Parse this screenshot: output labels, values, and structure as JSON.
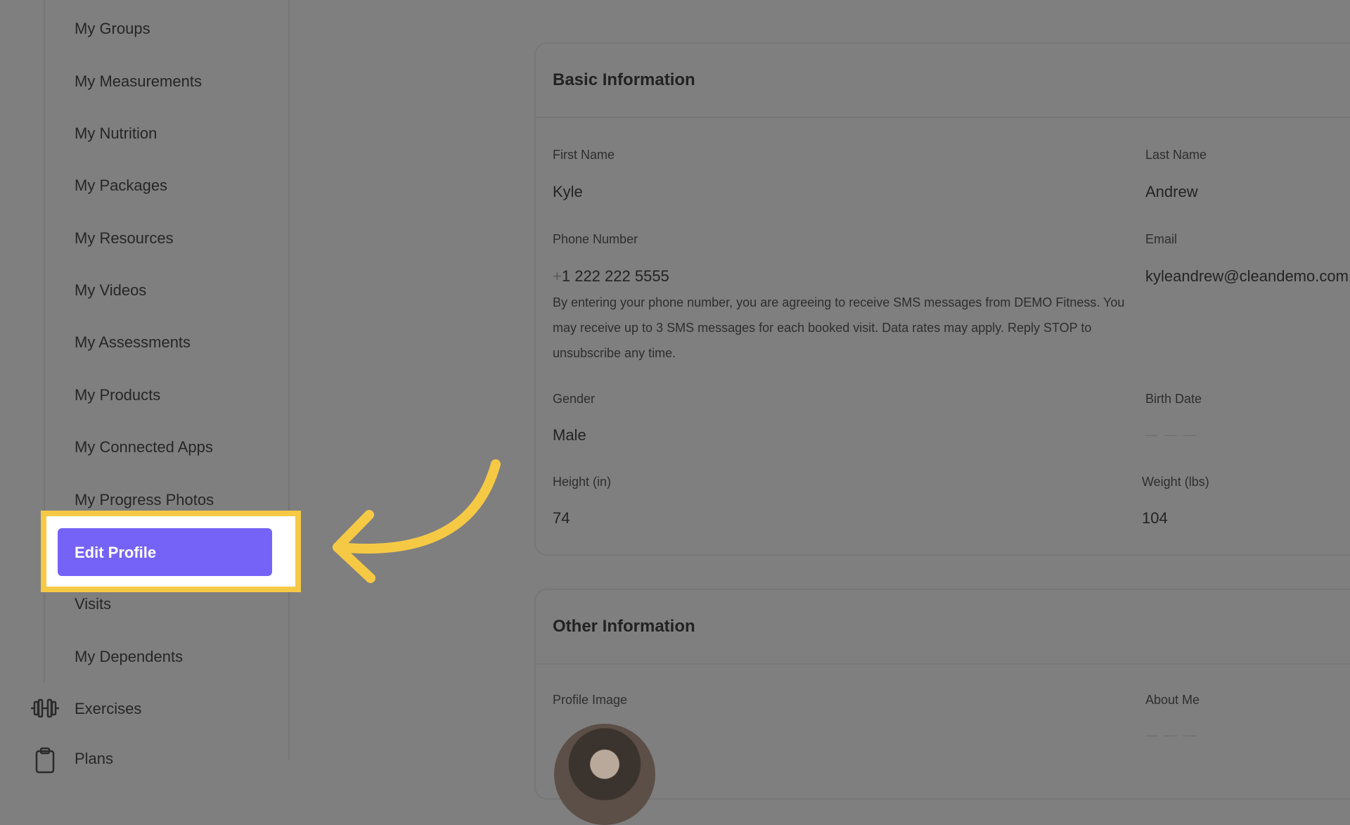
{
  "sidebar": {
    "items": [
      {
        "label": "My Groups"
      },
      {
        "label": "My Measurements"
      },
      {
        "label": "My Nutrition"
      },
      {
        "label": "My Packages"
      },
      {
        "label": "My Resources"
      },
      {
        "label": "My Videos"
      },
      {
        "label": "My Assessments"
      },
      {
        "label": "My Products"
      },
      {
        "label": "My Connected Apps"
      },
      {
        "label": "My Progress Photos"
      }
    ],
    "active_item": {
      "label": "Edit Profile"
    },
    "items_after": [
      {
        "label": "Visits"
      },
      {
        "label": "My Dependents"
      }
    ],
    "top_items": [
      {
        "label": "Exercises",
        "icon": "dumbbell-icon"
      },
      {
        "label": "Plans",
        "icon": "clipboard-icon"
      }
    ]
  },
  "basic_info": {
    "title": "Basic Information",
    "first_name": {
      "label": "First Name",
      "value": "Kyle"
    },
    "last_name": {
      "label": "Last Name",
      "value": "Andrew"
    },
    "phone": {
      "label": "Phone Number",
      "prefix": "+",
      "value": "1 222 222 5555"
    },
    "email": {
      "label": "Email",
      "value": "kyleandrew@cleandemo.com"
    },
    "sms_notice": "By entering your phone number, you are agreeing to receive SMS messages from DEMO Fitness. You may receive up to 3 SMS messages for each booked visit. Data rates may apply. Reply STOP to unsubscribe any time.",
    "gender": {
      "label": "Gender",
      "value": "Male"
    },
    "birth_date": {
      "label": "Birth Date",
      "value": "— — —"
    },
    "height": {
      "label": "Height (in)",
      "value": "74"
    },
    "weight": {
      "label": "Weight (lbs)",
      "value": "104"
    }
  },
  "other_info": {
    "title": "Other Information",
    "profile_image": {
      "label": "Profile Image"
    },
    "about_me": {
      "label": "About Me",
      "value": "— — —"
    }
  },
  "colors": {
    "highlight": "#f6c945",
    "active_button": "#7563f8",
    "overlay": "#7f7f7f"
  }
}
